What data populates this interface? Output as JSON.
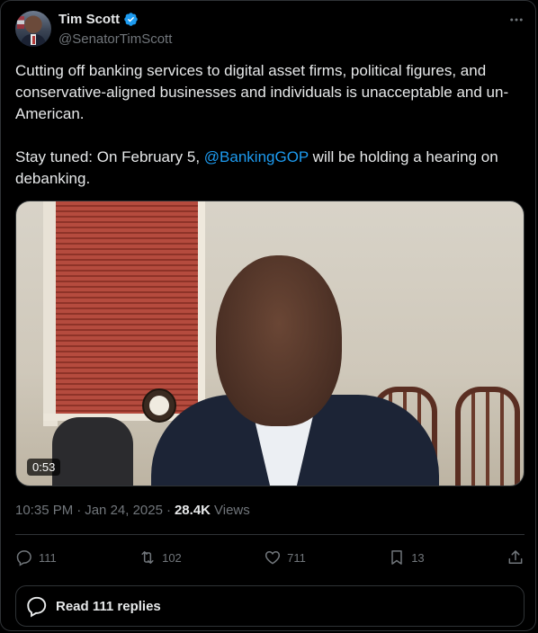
{
  "author": {
    "name": "Tim Scott",
    "handle": "@SenatorTimScott",
    "verified": true
  },
  "tweet": {
    "text_part1": "Cutting off banking services to digital asset firms, political figures, and conservative-aligned businesses and individuals is unacceptable and un-American.\n\nStay tuned: On February 5, ",
    "mention": "@BankingGOP",
    "text_part2": " will be holding a hearing on debanking."
  },
  "media": {
    "duration": "0:53"
  },
  "meta": {
    "time": "10:35 PM",
    "separator1": "·",
    "date": "Jan 24, 2025",
    "separator2": "·",
    "views_count": "28.4K",
    "views_label": "Views"
  },
  "actions": {
    "replies": "111",
    "reposts": "102",
    "likes": "711",
    "bookmarks": "13"
  },
  "read_replies_label": "Read 111 replies",
  "colors": {
    "background": "#000000",
    "text": "#e7e9ea",
    "muted": "#71767b",
    "link": "#1d9bf0",
    "border": "#2f3336"
  }
}
